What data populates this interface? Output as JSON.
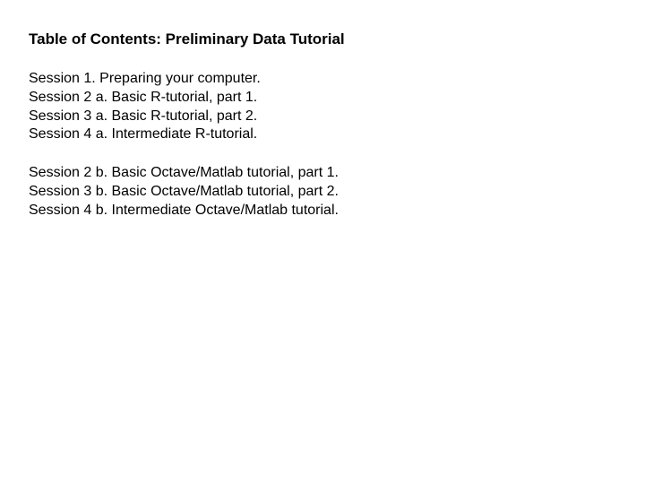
{
  "title": "Table of Contents: Preliminary Data Tutorial",
  "group_a": {
    "line1": "Session 1.  Preparing your computer.",
    "line2": "Session 2 a.  Basic R-tutorial, part 1.",
    "line3": "Session 3 a. Basic R-tutorial, part 2.",
    "line4": "Session 4 a. Intermediate R-tutorial."
  },
  "group_b": {
    "line1": "Session 2 b. Basic Octave/Matlab tutorial, part 1.",
    "line2": "Session 3 b. Basic Octave/Matlab tutorial, part 2.",
    "line3": "Session 4 b. Intermediate Octave/Matlab tutorial."
  }
}
